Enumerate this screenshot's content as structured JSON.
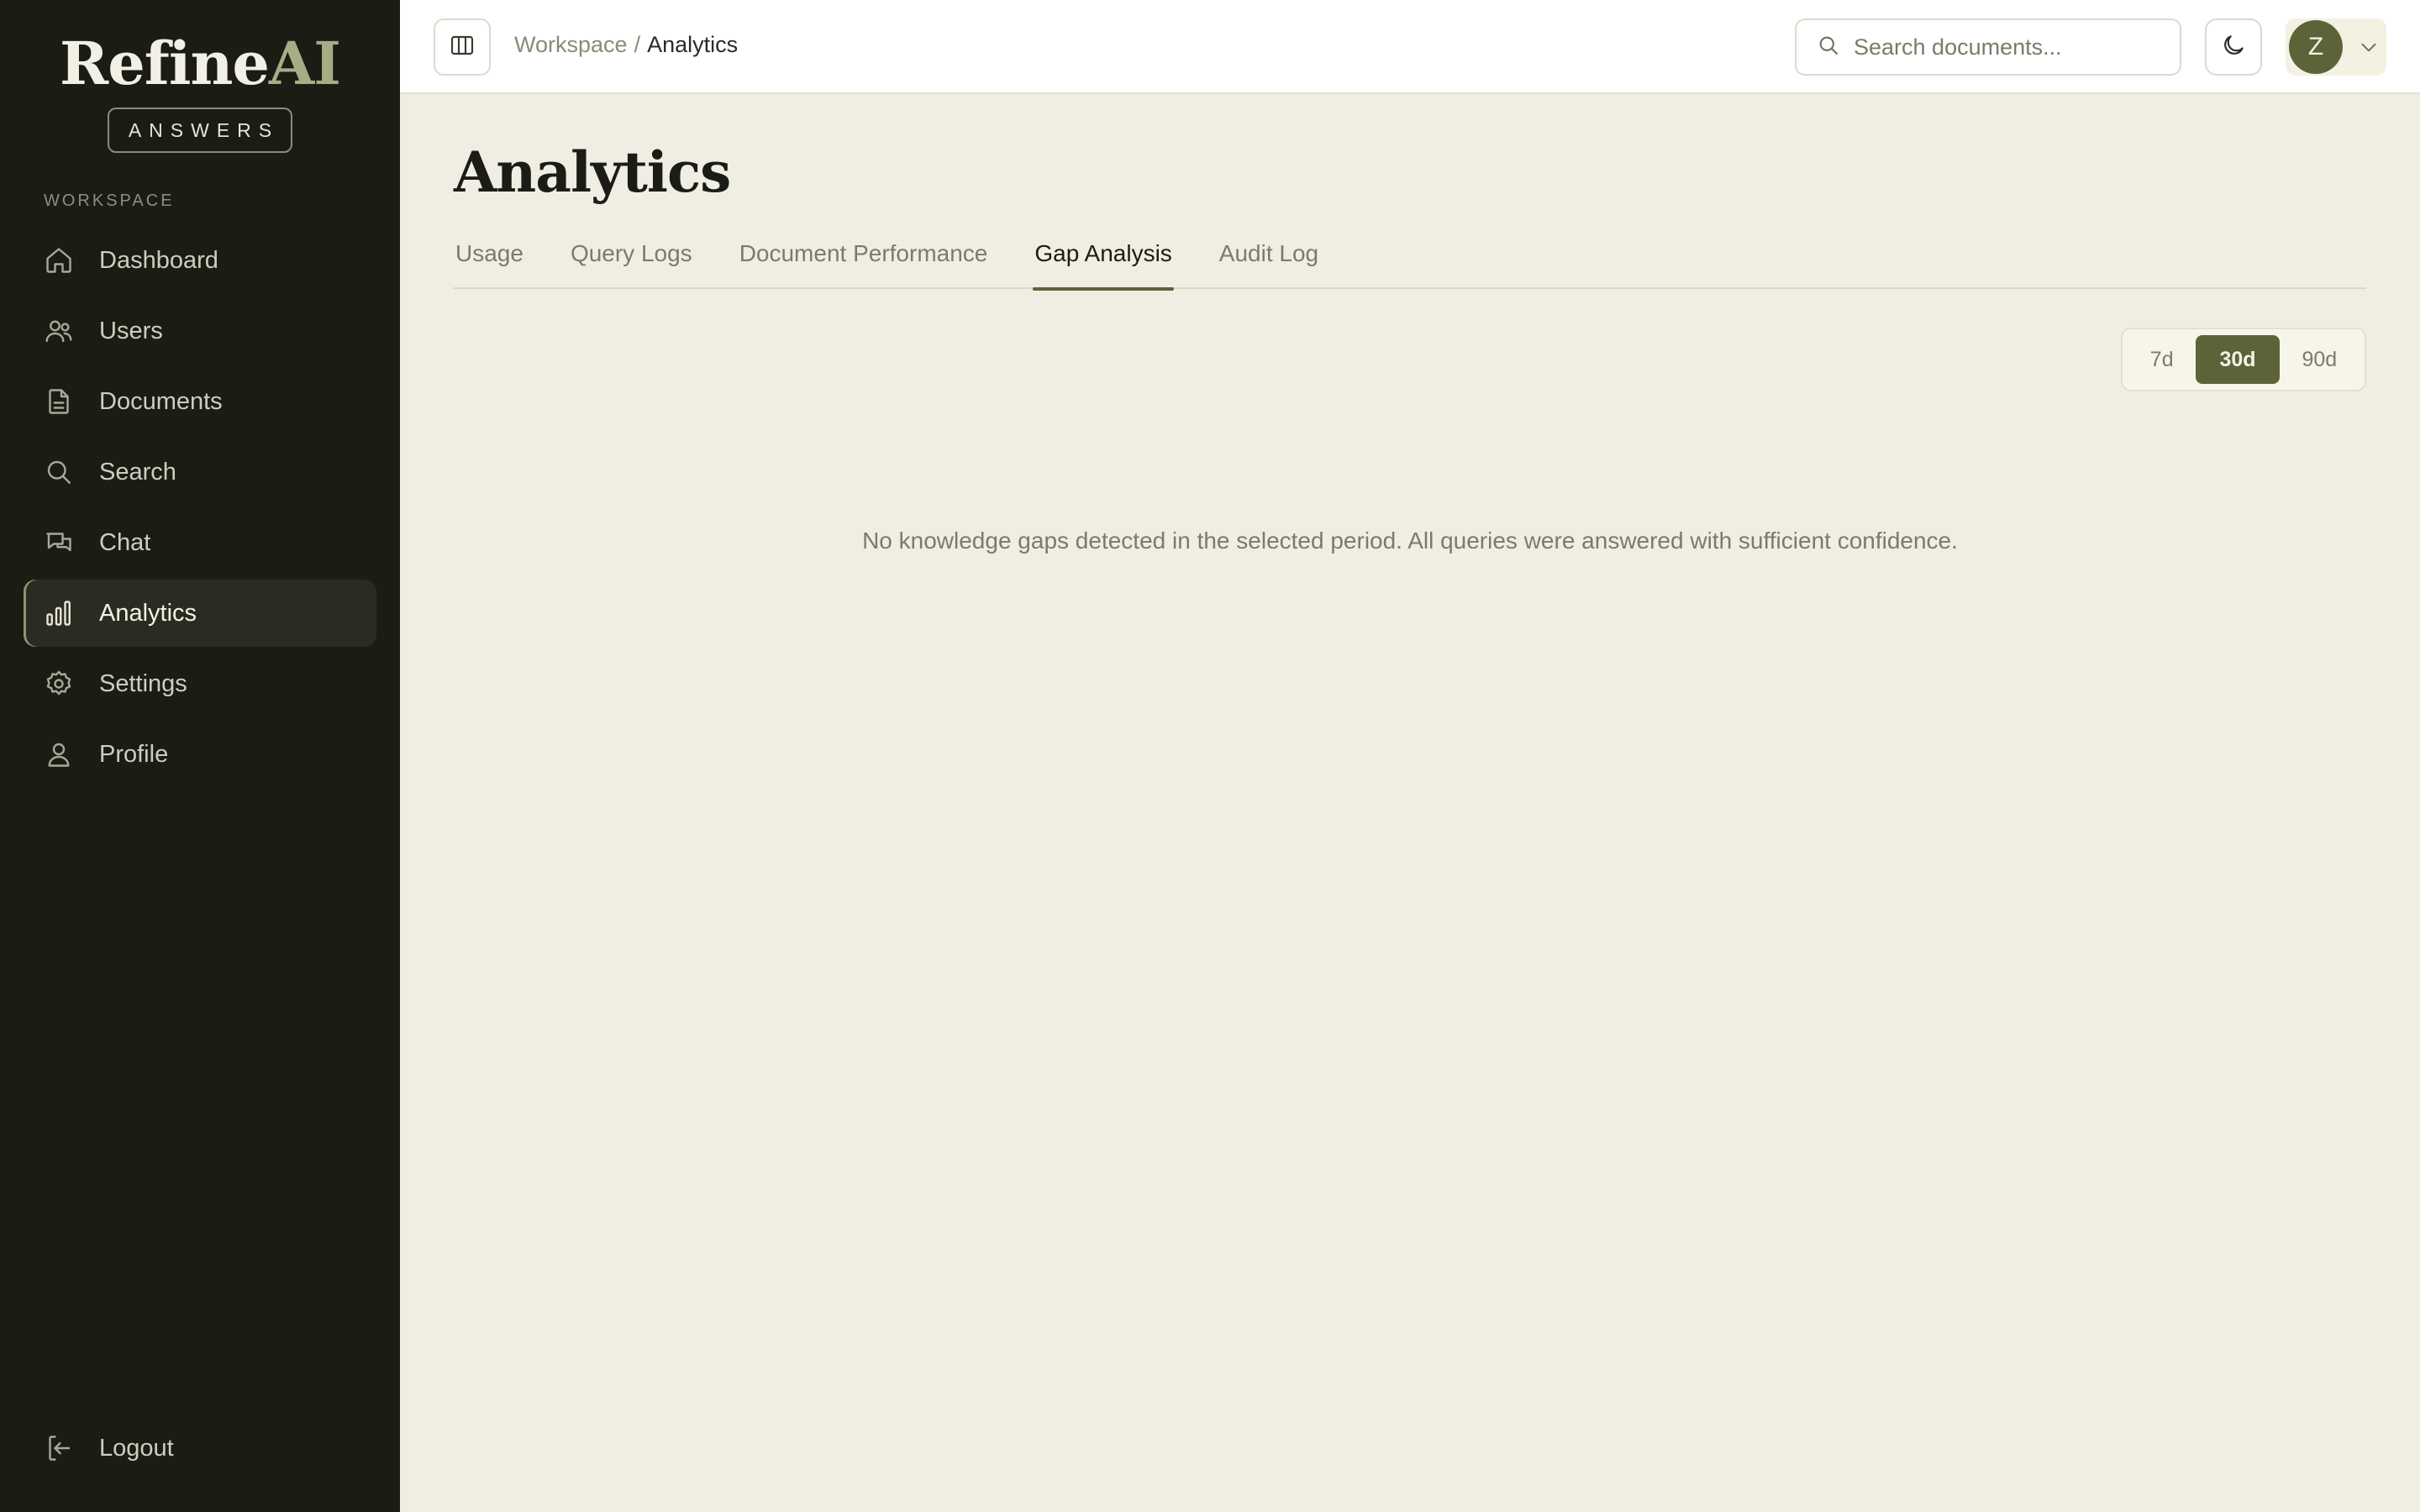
{
  "brand": {
    "name_main": "Refine",
    "name_accent": "AI",
    "badge": "ANSWERS"
  },
  "sidebar": {
    "section_label": "WORKSPACE",
    "items": [
      {
        "label": "Dashboard",
        "icon": "home-icon"
      },
      {
        "label": "Users",
        "icon": "users-icon"
      },
      {
        "label": "Documents",
        "icon": "document-icon"
      },
      {
        "label": "Search",
        "icon": "search-icon"
      },
      {
        "label": "Chat",
        "icon": "chat-icon"
      },
      {
        "label": "Analytics",
        "icon": "bar-chart-icon",
        "active": true
      },
      {
        "label": "Settings",
        "icon": "gear-icon"
      },
      {
        "label": "Profile",
        "icon": "user-icon"
      }
    ],
    "logout_label": "Logout"
  },
  "header": {
    "breadcrumb": {
      "parent": "Workspace",
      "separator": "/",
      "current": "Analytics"
    },
    "search_placeholder": "Search documents...",
    "avatar_initial": "Z"
  },
  "page": {
    "title": "Analytics",
    "tabs": [
      {
        "label": "Usage"
      },
      {
        "label": "Query Logs"
      },
      {
        "label": "Document Performance"
      },
      {
        "label": "Gap Analysis",
        "active": true
      },
      {
        "label": "Audit Log"
      }
    ],
    "range_options": [
      "7d",
      "30d",
      "90d"
    ],
    "range_selected": "30d",
    "empty_message": "No knowledge gaps detected in the selected period. All queries were answered with sufficient confidence."
  },
  "colors": {
    "sidebar_bg": "#1b1c14",
    "page_bg": "#f0eee2",
    "accent": "#5c6338"
  }
}
